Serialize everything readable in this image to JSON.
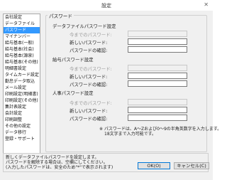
{
  "window": {
    "title": "設定",
    "close_glyph": "✕"
  },
  "sidebar": {
    "items": [
      "会社設定",
      "データファイル",
      "パスワード",
      "マイナンバー",
      "給与基本(一般)",
      "給与基本(社会)",
      "給与基本(源泉)",
      "給与基本(その他)",
      "明細書設定",
      "タイムカード設定",
      "勤怠データ取込",
      "メール設定",
      "印刷設定(明細書)",
      "印刷設定(その他)",
      "集計表設定",
      "会計設定",
      "印刷調整",
      "その他の設定",
      "データ移行",
      "登録・サポート"
    ],
    "selected_index": 2
  },
  "panel": {
    "title": "パスワード",
    "sections": [
      {
        "title": "データファイルパスワード設定"
      },
      {
        "title": "給与パスワード設定"
      },
      {
        "title": "人事パスワード設定"
      }
    ],
    "labels": {
      "current": "今までのパスワード:",
      "new": "新しいパスワード:",
      "confirm": "パスワードの確認:"
    },
    "note_line1": "※ パスワードは、A～Zおよび0～9の半角英数字を入力します。",
    "note_line2": "18文字まで入力可能です。"
  },
  "description": {
    "line1": "新しくデータファイルパスワードを設定します。",
    "line2": "パスワードを解除する場合は、空欄にしてください。",
    "line3": "(入力したパスワードは、安全のため\"*\"で表示されます)"
  },
  "buttons": {
    "ok": "OK(O)",
    "cancel": "キャンセル(C)"
  }
}
